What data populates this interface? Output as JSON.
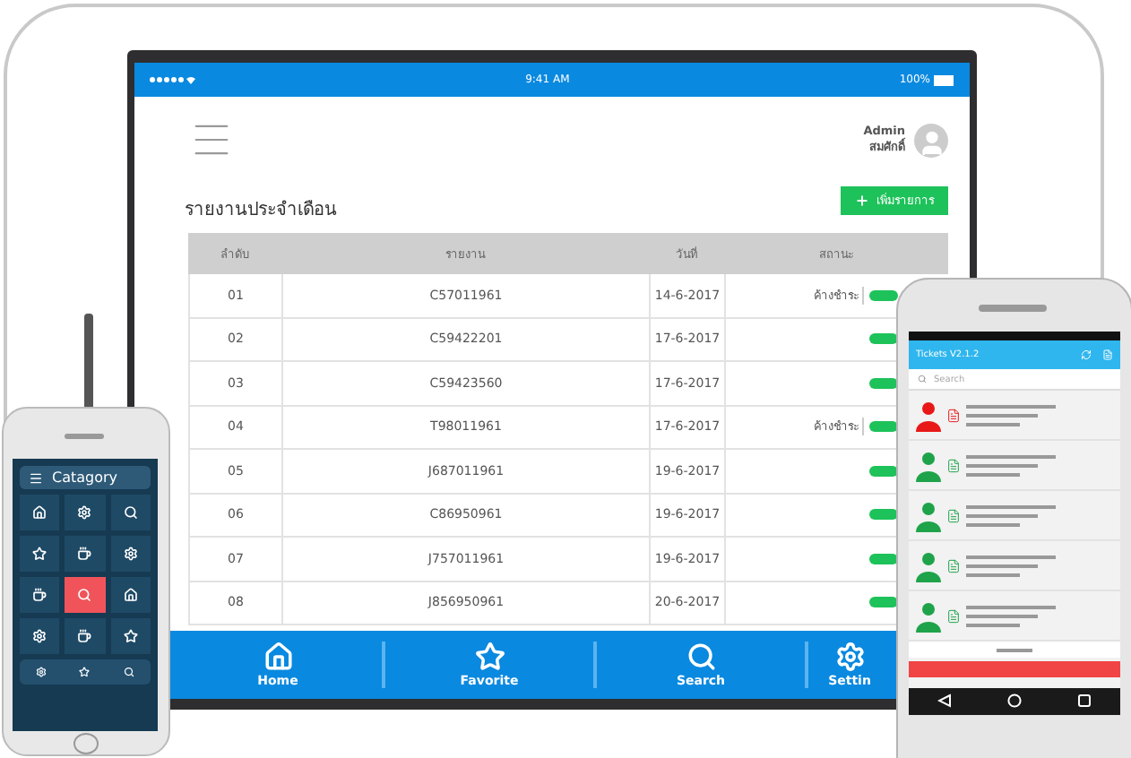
{
  "tablet": {
    "status_bar": {
      "time": "9:41 AM",
      "battery": "100%"
    },
    "user": {
      "name": "Admin",
      "subtitle": "สมศักดิ์"
    },
    "title": "รายงานประจำเดือน",
    "add_button": "เพิ่มรายการ",
    "table": {
      "columns": [
        "ลำดับ",
        "รายงาน",
        "วันที่",
        "สถานะ"
      ],
      "rows": [
        {
          "no": "01",
          "report": "C57011961",
          "date": "14-6-2017",
          "status": "ค้างชำระ"
        },
        {
          "no": "02",
          "report": "C59422201",
          "date": "17-6-2017",
          "status": ""
        },
        {
          "no": "03",
          "report": "C59423560",
          "date": "17-6-2017",
          "status": ""
        },
        {
          "no": "04",
          "report": "T98011961",
          "date": "17-6-2017",
          "status": "ค้างชำระ"
        },
        {
          "no": "05",
          "report": "J687011961",
          "date": "19-6-2017",
          "status": ""
        },
        {
          "no": "06",
          "report": "C86950961",
          "date": "19-6-2017",
          "status": ""
        },
        {
          "no": "07",
          "report": "J757011961",
          "date": "19-6-2017",
          "status": ""
        },
        {
          "no": "08",
          "report": "J856950961",
          "date": "20-6-2017",
          "status": ""
        }
      ]
    },
    "nav": [
      {
        "label": "Home",
        "kind": "home"
      },
      {
        "label": "Favorite",
        "kind": "star"
      },
      {
        "label": "Search",
        "kind": "search"
      },
      {
        "label": "Settin",
        "kind": "gear"
      }
    ]
  },
  "left_phone": {
    "title": "Catagory",
    "tiles": [
      {
        "kind": "home",
        "selected": false
      },
      {
        "kind": "gear",
        "selected": false
      },
      {
        "kind": "search",
        "selected": false
      },
      {
        "kind": "star",
        "selected": false
      },
      {
        "kind": "cup",
        "selected": false
      },
      {
        "kind": "gear",
        "selected": false
      },
      {
        "kind": "cup",
        "selected": false
      },
      {
        "kind": "search",
        "selected": true
      },
      {
        "kind": "home",
        "selected": false
      },
      {
        "kind": "gear",
        "selected": false
      },
      {
        "kind": "cup",
        "selected": false
      },
      {
        "kind": "star",
        "selected": false
      }
    ],
    "bottom": [
      {
        "kind": "gear"
      },
      {
        "kind": "star"
      },
      {
        "kind": "search"
      }
    ]
  },
  "right_phone": {
    "title": "Tickets V2.1.2",
    "search": {
      "placeholder": "Search"
    },
    "tickets": [
      {
        "color": "#e81818"
      },
      {
        "color": "#1fa34a"
      },
      {
        "color": "#1fa34a"
      },
      {
        "color": "#1fa34a"
      },
      {
        "color": "#1fa34a"
      }
    ]
  }
}
